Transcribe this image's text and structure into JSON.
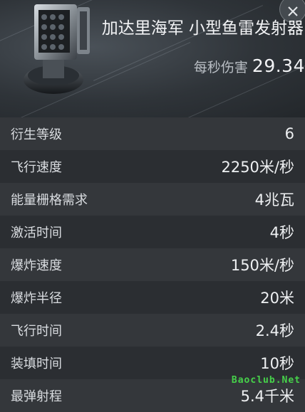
{
  "header": {
    "title": "加达里海军 小型鱼雷发射器",
    "dps_label": "每秒伤害",
    "dps_value": "29.34"
  },
  "stats": [
    {
      "label": "衍生等级",
      "value": "6"
    },
    {
      "label": "飞行速度",
      "value": "2250米/秒"
    },
    {
      "label": "能量栅格需求",
      "value": "4兆瓦"
    },
    {
      "label": "激活时间",
      "value": "4秒"
    },
    {
      "label": "爆炸速度",
      "value": "150米/秒"
    },
    {
      "label": "爆炸半径",
      "value": "20米"
    },
    {
      "label": "飞行时间",
      "value": "2.4秒"
    },
    {
      "label": "装填时间",
      "value": "10秒"
    },
    {
      "label": "最弹射程",
      "value": "5.4千米"
    }
  ],
  "watermark": "Baoclub.Net"
}
